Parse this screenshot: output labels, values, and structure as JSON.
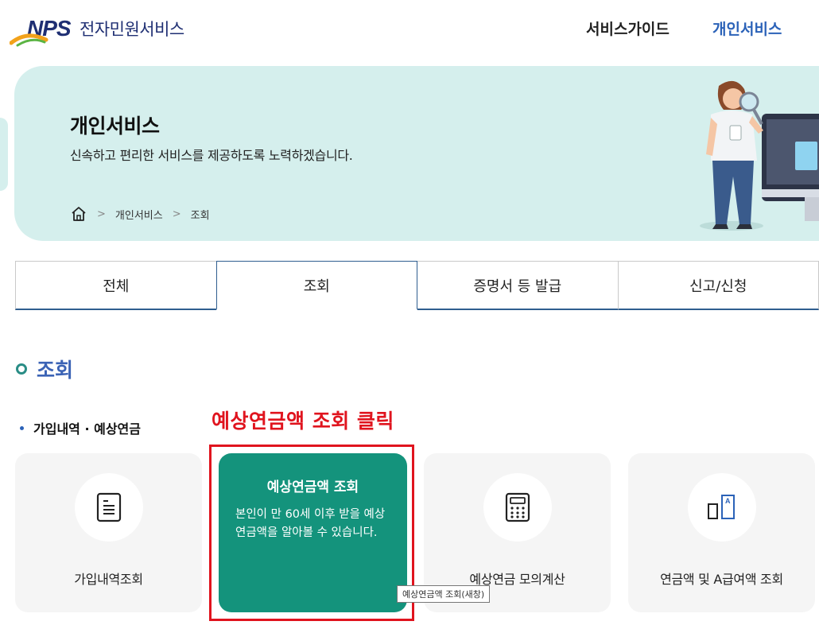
{
  "header": {
    "logo_mark": "NPS",
    "logo_title": "전자민원서비스",
    "nav": [
      {
        "label": "서비스가이드"
      },
      {
        "label": "개인서비스"
      }
    ]
  },
  "banner": {
    "title": "개인서비스",
    "subtitle": "신속하고 편리한 서비스를 제공하도록 노력하겠습니다.",
    "breadcrumb": [
      "개인서비스",
      "조회"
    ]
  },
  "tabs": [
    {
      "label": "전체"
    },
    {
      "label": "조회"
    },
    {
      "label": "증명서 등 발급"
    },
    {
      "label": "신고/신청"
    }
  ],
  "section": {
    "title": "조회",
    "subheading": "가입내역 · 예상연금"
  },
  "annotation": "예상연금액 조회 클릭",
  "cards": [
    {
      "label": "가입내역조회",
      "icon": "document-icon"
    },
    {
      "title": "예상연금액 조회",
      "description": "본인이 만 60세 이후 받을 예상연금액을 알아볼 수 있습니다."
    },
    {
      "label": "예상연금 모의계산",
      "icon": "calculator-icon"
    },
    {
      "label": "연금액 및 A급여액 조회",
      "icon": "a-grade-icon"
    }
  ],
  "tooltip": "예상연금액 조회(새창)",
  "colors": {
    "brand_navy": "#1f2f73",
    "link_blue": "#2b62b8",
    "banner_bg": "#d5efed",
    "active_card": "#14937c",
    "annotation_red": "#e0141e"
  }
}
